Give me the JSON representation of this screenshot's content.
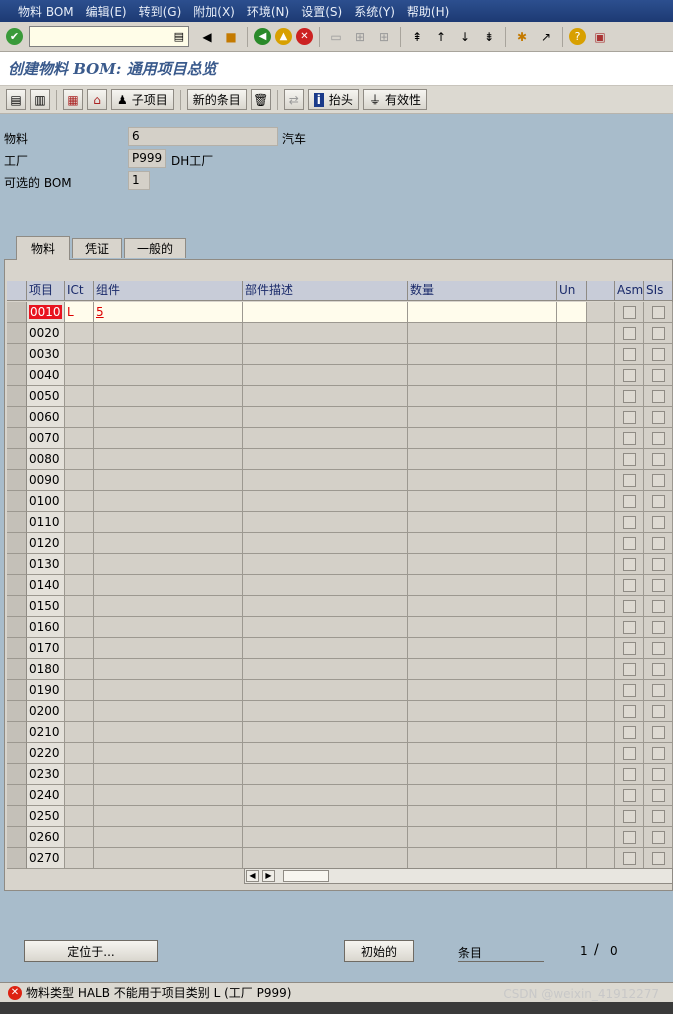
{
  "menu": [
    "物料 BOM",
    "编辑(E)",
    "转到(G)",
    "附加(X)",
    "环境(N)",
    "设置(S)",
    "系统(Y)",
    "帮助(H)"
  ],
  "title": "创建物料 BOM: 通用项目总览",
  "app_toolbar": {
    "subitem_label": "子项目",
    "new_entries_label": "新的条目",
    "header_label": "抬头",
    "validity_label": "有效性"
  },
  "header": {
    "material_label": "物料",
    "material_value": "6",
    "material_desc": "汽车",
    "plant_label": "工厂",
    "plant_value": "P999",
    "plant_desc": "DH工厂",
    "alt_bom_label": "可选的 BOM",
    "alt_bom_value": "1"
  },
  "tabs": [
    "物料",
    "凭证",
    "一般的"
  ],
  "table": {
    "columns": [
      "项目",
      "ICt",
      "组件",
      "部件描述",
      "数量",
      "Un",
      "",
      "Asm",
      "SIs"
    ],
    "rows": [
      {
        "item": "0010",
        "ict": "L",
        "component": "5"
      },
      {
        "item": "0020"
      },
      {
        "item": "0030"
      },
      {
        "item": "0040"
      },
      {
        "item": "0050"
      },
      {
        "item": "0060"
      },
      {
        "item": "0070"
      },
      {
        "item": "0080"
      },
      {
        "item": "0090"
      },
      {
        "item": "0100"
      },
      {
        "item": "0110"
      },
      {
        "item": "0120"
      },
      {
        "item": "0130"
      },
      {
        "item": "0140"
      },
      {
        "item": "0150"
      },
      {
        "item": "0160"
      },
      {
        "item": "0170"
      },
      {
        "item": "0180"
      },
      {
        "item": "0190"
      },
      {
        "item": "0200"
      },
      {
        "item": "0210"
      },
      {
        "item": "0220"
      },
      {
        "item": "0230"
      },
      {
        "item": "0240"
      },
      {
        "item": "0250"
      },
      {
        "item": "0260"
      },
      {
        "item": "0270"
      }
    ]
  },
  "bottom": {
    "position_label": "定位于...",
    "initial_label": "初始的",
    "entry_label": "条目",
    "page_current": "1",
    "page_total": "0"
  },
  "status": {
    "message": "物料类型 HALB 不能用于项目类别 L (工厂 P999)",
    "watermark": "CSDN @weixin_41912277"
  }
}
